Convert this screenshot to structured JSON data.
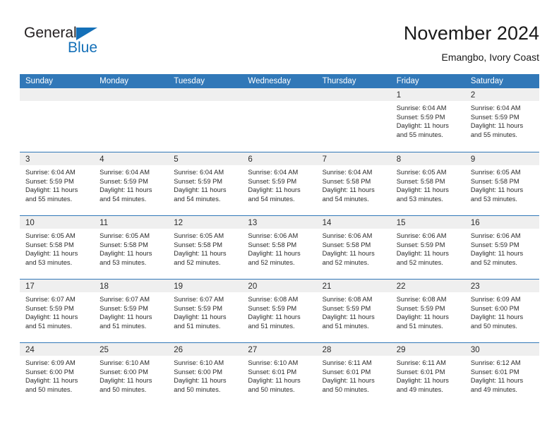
{
  "logo": {
    "word_dark": "General",
    "word_blue": "Blue",
    "triangle_icon": "blue-triangle-icon",
    "brand_blue": "#1470b8"
  },
  "header": {
    "title": "November 2024",
    "subtitle": "Emangbo, Ivory Coast"
  },
  "theme": {
    "header_blue": "#3178b8",
    "day_band_gray": "#efefef",
    "text": "#2b2b2b"
  },
  "weekdays": [
    "Sunday",
    "Monday",
    "Tuesday",
    "Wednesday",
    "Thursday",
    "Friday",
    "Saturday"
  ],
  "weeks": [
    [
      {
        "day": "",
        "lines": []
      },
      {
        "day": "",
        "lines": []
      },
      {
        "day": "",
        "lines": []
      },
      {
        "day": "",
        "lines": []
      },
      {
        "day": "",
        "lines": []
      },
      {
        "day": "1",
        "lines": [
          "Sunrise: 6:04 AM",
          "Sunset: 5:59 PM",
          "Daylight: 11 hours",
          "and 55 minutes."
        ]
      },
      {
        "day": "2",
        "lines": [
          "Sunrise: 6:04 AM",
          "Sunset: 5:59 PM",
          "Daylight: 11 hours",
          "and 55 minutes."
        ]
      }
    ],
    [
      {
        "day": "3",
        "lines": [
          "Sunrise: 6:04 AM",
          "Sunset: 5:59 PM",
          "Daylight: 11 hours",
          "and 55 minutes."
        ]
      },
      {
        "day": "4",
        "lines": [
          "Sunrise: 6:04 AM",
          "Sunset: 5:59 PM",
          "Daylight: 11 hours",
          "and 54 minutes."
        ]
      },
      {
        "day": "5",
        "lines": [
          "Sunrise: 6:04 AM",
          "Sunset: 5:59 PM",
          "Daylight: 11 hours",
          "and 54 minutes."
        ]
      },
      {
        "day": "6",
        "lines": [
          "Sunrise: 6:04 AM",
          "Sunset: 5:59 PM",
          "Daylight: 11 hours",
          "and 54 minutes."
        ]
      },
      {
        "day": "7",
        "lines": [
          "Sunrise: 6:04 AM",
          "Sunset: 5:58 PM",
          "Daylight: 11 hours",
          "and 54 minutes."
        ]
      },
      {
        "day": "8",
        "lines": [
          "Sunrise: 6:05 AM",
          "Sunset: 5:58 PM",
          "Daylight: 11 hours",
          "and 53 minutes."
        ]
      },
      {
        "day": "9",
        "lines": [
          "Sunrise: 6:05 AM",
          "Sunset: 5:58 PM",
          "Daylight: 11 hours",
          "and 53 minutes."
        ]
      }
    ],
    [
      {
        "day": "10",
        "lines": [
          "Sunrise: 6:05 AM",
          "Sunset: 5:58 PM",
          "Daylight: 11 hours",
          "and 53 minutes."
        ]
      },
      {
        "day": "11",
        "lines": [
          "Sunrise: 6:05 AM",
          "Sunset: 5:58 PM",
          "Daylight: 11 hours",
          "and 53 minutes."
        ]
      },
      {
        "day": "12",
        "lines": [
          "Sunrise: 6:05 AM",
          "Sunset: 5:58 PM",
          "Daylight: 11 hours",
          "and 52 minutes."
        ]
      },
      {
        "day": "13",
        "lines": [
          "Sunrise: 6:06 AM",
          "Sunset: 5:58 PM",
          "Daylight: 11 hours",
          "and 52 minutes."
        ]
      },
      {
        "day": "14",
        "lines": [
          "Sunrise: 6:06 AM",
          "Sunset: 5:58 PM",
          "Daylight: 11 hours",
          "and 52 minutes."
        ]
      },
      {
        "day": "15",
        "lines": [
          "Sunrise: 6:06 AM",
          "Sunset: 5:59 PM",
          "Daylight: 11 hours",
          "and 52 minutes."
        ]
      },
      {
        "day": "16",
        "lines": [
          "Sunrise: 6:06 AM",
          "Sunset: 5:59 PM",
          "Daylight: 11 hours",
          "and 52 minutes."
        ]
      }
    ],
    [
      {
        "day": "17",
        "lines": [
          "Sunrise: 6:07 AM",
          "Sunset: 5:59 PM",
          "Daylight: 11 hours",
          "and 51 minutes."
        ]
      },
      {
        "day": "18",
        "lines": [
          "Sunrise: 6:07 AM",
          "Sunset: 5:59 PM",
          "Daylight: 11 hours",
          "and 51 minutes."
        ]
      },
      {
        "day": "19",
        "lines": [
          "Sunrise: 6:07 AM",
          "Sunset: 5:59 PM",
          "Daylight: 11 hours",
          "and 51 minutes."
        ]
      },
      {
        "day": "20",
        "lines": [
          "Sunrise: 6:08 AM",
          "Sunset: 5:59 PM",
          "Daylight: 11 hours",
          "and 51 minutes."
        ]
      },
      {
        "day": "21",
        "lines": [
          "Sunrise: 6:08 AM",
          "Sunset: 5:59 PM",
          "Daylight: 11 hours",
          "and 51 minutes."
        ]
      },
      {
        "day": "22",
        "lines": [
          "Sunrise: 6:08 AM",
          "Sunset: 5:59 PM",
          "Daylight: 11 hours",
          "and 51 minutes."
        ]
      },
      {
        "day": "23",
        "lines": [
          "Sunrise: 6:09 AM",
          "Sunset: 6:00 PM",
          "Daylight: 11 hours",
          "and 50 minutes."
        ]
      }
    ],
    [
      {
        "day": "24",
        "lines": [
          "Sunrise: 6:09 AM",
          "Sunset: 6:00 PM",
          "Daylight: 11 hours",
          "and 50 minutes."
        ]
      },
      {
        "day": "25",
        "lines": [
          "Sunrise: 6:10 AM",
          "Sunset: 6:00 PM",
          "Daylight: 11 hours",
          "and 50 minutes."
        ]
      },
      {
        "day": "26",
        "lines": [
          "Sunrise: 6:10 AM",
          "Sunset: 6:00 PM",
          "Daylight: 11 hours",
          "and 50 minutes."
        ]
      },
      {
        "day": "27",
        "lines": [
          "Sunrise: 6:10 AM",
          "Sunset: 6:01 PM",
          "Daylight: 11 hours",
          "and 50 minutes."
        ]
      },
      {
        "day": "28",
        "lines": [
          "Sunrise: 6:11 AM",
          "Sunset: 6:01 PM",
          "Daylight: 11 hours",
          "and 50 minutes."
        ]
      },
      {
        "day": "29",
        "lines": [
          "Sunrise: 6:11 AM",
          "Sunset: 6:01 PM",
          "Daylight: 11 hours",
          "and 49 minutes."
        ]
      },
      {
        "day": "30",
        "lines": [
          "Sunrise: 6:12 AM",
          "Sunset: 6:01 PM",
          "Daylight: 11 hours",
          "and 49 minutes."
        ]
      }
    ]
  ]
}
